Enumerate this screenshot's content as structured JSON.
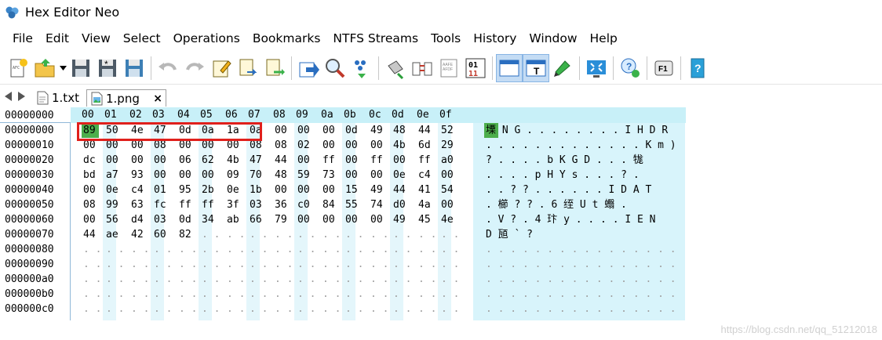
{
  "window": {
    "title": "Hex Editor Neo"
  },
  "menu": [
    "File",
    "Edit",
    "View",
    "Select",
    "Operations",
    "Bookmarks",
    "NTFS Streams",
    "Tools",
    "History",
    "Window",
    "Help"
  ],
  "tabs": [
    {
      "label": "1.txt",
      "active": false
    },
    {
      "label": "1.png",
      "active": true,
      "close": "×"
    }
  ],
  "hex": {
    "header_address": "00000000",
    "column_headers": [
      "00",
      "01",
      "02",
      "03",
      "04",
      "05",
      "06",
      "07",
      "08",
      "09",
      "0a",
      "0b",
      "0c",
      "0d",
      "0e",
      "0f"
    ],
    "rows": [
      {
        "addr": "00000000",
        "bytes": [
          "89",
          "50",
          "4e",
          "47",
          "0d",
          "0a",
          "1a",
          "0a",
          "00",
          "00",
          "00",
          "0d",
          "49",
          "48",
          "44",
          "52"
        ],
        "text": "塛 N G . . . . . . . . I H D R"
      },
      {
        "addr": "00000010",
        "bytes": [
          "00",
          "00",
          "00",
          "08",
          "00",
          "00",
          "00",
          "08",
          "08",
          "02",
          "00",
          "00",
          "00",
          "4b",
          "6d",
          "29"
        ],
        "text": ". . . . . . . . . . . . . K m )"
      },
      {
        "addr": "00000020",
        "bytes": [
          "dc",
          "00",
          "00",
          "00",
          "06",
          "62",
          "4b",
          "47",
          "44",
          "00",
          "ff",
          "00",
          "ff",
          "00",
          "ff",
          "a0"
        ],
        "text": "? . . . . b K G D .   .   .  牻"
      },
      {
        "addr": "00000030",
        "bytes": [
          "bd",
          "a7",
          "93",
          "00",
          "00",
          "00",
          "09",
          "70",
          "48",
          "59",
          "73",
          "00",
          "00",
          "0e",
          "c4",
          "00"
        ],
        "text": "      . . . . p H Y s . . . ? ."
      },
      {
        "addr": "00000040",
        "bytes": [
          "00",
          "0e",
          "c4",
          "01",
          "95",
          "2b",
          "0e",
          "1b",
          "00",
          "00",
          "00",
          "15",
          "49",
          "44",
          "41",
          "54"
        ],
        "text": ". . ?   ?   . . . . . . I D A T"
      },
      {
        "addr": "00000050",
        "bytes": [
          "08",
          "99",
          "63",
          "fc",
          "ff",
          "ff",
          "3f",
          "03",
          "36",
          "c0",
          "84",
          "55",
          "74",
          "d0",
          "4a",
          "00"
        ],
        "text": ". 櫛  ?    ? . 6 绖 U t 蠮 ."
      },
      {
        "addr": "00000060",
        "bytes": [
          "00",
          "56",
          "d4",
          "03",
          "0d",
          "34",
          "ab",
          "66",
          "79",
          "00",
          "00",
          "00",
          "00",
          "49",
          "45",
          "4e"
        ],
        "text": ". V ?  . 4 玣  y . . . . I E N"
      },
      {
        "addr": "00000070",
        "bytes": [
          "44",
          "ae",
          "42",
          "60",
          "82",
          "",
          "",
          "",
          "",
          "",
          "",
          "",
          "",
          "",
          "",
          ""
        ],
        "text": "D 瓸  ` ?"
      },
      {
        "addr": "00000080",
        "bytes": [
          "",
          "",
          "",
          "",
          "",
          "",
          "",
          "",
          "",
          "",
          "",
          "",
          "",
          "",
          "",
          ""
        ],
        "text": ""
      },
      {
        "addr": "00000090",
        "bytes": [
          "",
          "",
          "",
          "",
          "",
          "",
          "",
          "",
          "",
          "",
          "",
          "",
          "",
          "",
          "",
          ""
        ],
        "text": ""
      },
      {
        "addr": "000000a0",
        "bytes": [
          "",
          "",
          "",
          "",
          "",
          "",
          "",
          "",
          "",
          "",
          "",
          "",
          "",
          "",
          "",
          ""
        ],
        "text": ""
      },
      {
        "addr": "000000b0",
        "bytes": [
          "",
          "",
          "",
          "",
          "",
          "",
          "",
          "",
          "",
          "",
          "",
          "",
          "",
          "",
          "",
          ""
        ],
        "text": ""
      },
      {
        "addr": "000000c0",
        "bytes": [
          "",
          "",
          "",
          "",
          "",
          "",
          "",
          "",
          "",
          "",
          "",
          "",
          "",
          "",
          "",
          ""
        ],
        "text": ""
      }
    ],
    "selected_byte": "89"
  },
  "watermark": "https://blog.csdn.net/qq_51212018",
  "colors": {
    "selection": "#4cae4c",
    "highlight_box": "#e0201c",
    "header_bg": "#c8f0f8"
  }
}
